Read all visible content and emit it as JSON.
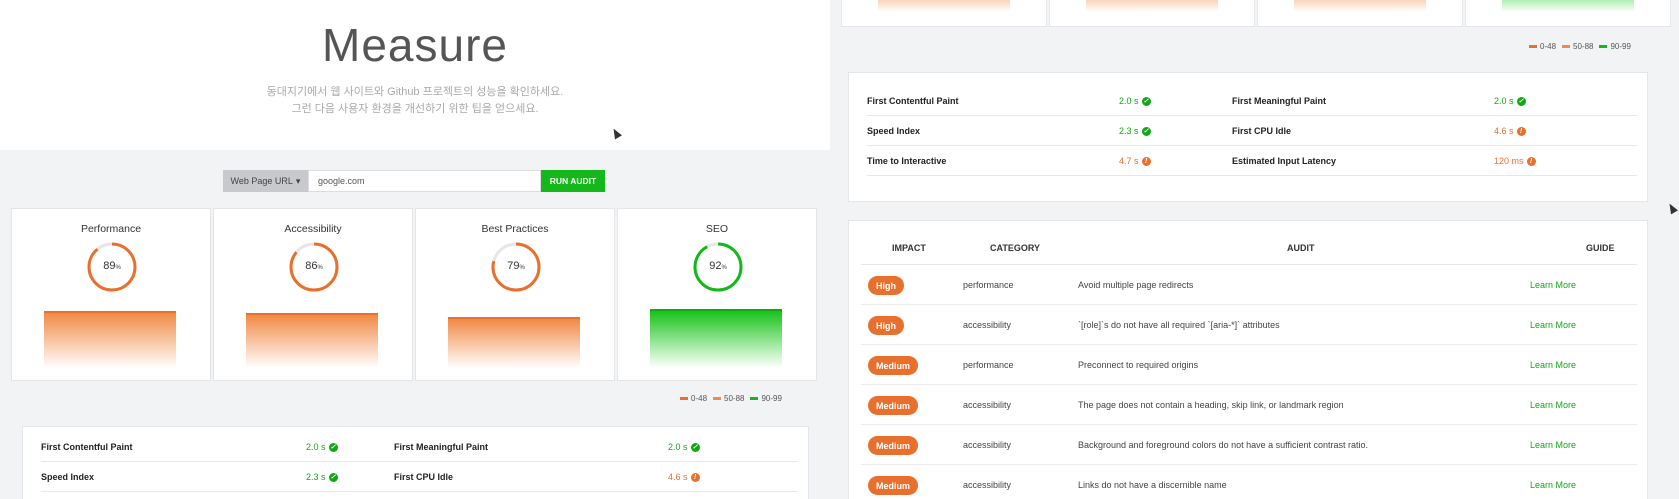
{
  "hero": {
    "title": "Measure",
    "subtitle_line1": "동대지기에서 웹 사이트와 Github 프로젝트의 성능을 확인하세요.",
    "subtitle_line2": "그런 다음 사용자 환경을 개선하기 위한 팁을 얻으세요."
  },
  "form": {
    "type_label": "Web Page URL",
    "url_value": "google.com",
    "run_label": "RUN AUDIT"
  },
  "categories": [
    {
      "title": "Performance",
      "score": "89",
      "pct": 0.89,
      "status": "orange"
    },
    {
      "title": "Accessibility",
      "score": "86",
      "pct": 0.86,
      "status": "orange"
    },
    {
      "title": "Best Practices",
      "score": "79",
      "pct": 0.79,
      "status": "orange"
    },
    {
      "title": "SEO",
      "score": "92",
      "pct": 0.92,
      "status": "green"
    }
  ],
  "score_unit": "%",
  "legend": [
    {
      "label": "0-48",
      "color": "#e8702c"
    },
    {
      "label": "50-88",
      "color": "#f08a45"
    },
    {
      "label": "90-99",
      "color": "#15b81a"
    }
  ],
  "metrics": [
    {
      "label": "First Contentful Paint",
      "value": "2.0 s",
      "status": "good"
    },
    {
      "label": "First Meaningful Paint",
      "value": "2.0 s",
      "status": "good"
    },
    {
      "label": "Speed Index",
      "value": "2.3 s",
      "status": "good"
    },
    {
      "label": "First CPU Idle",
      "value": "4.6 s",
      "status": "warn"
    },
    {
      "label": "Time to Interactive",
      "value": "4.7 s",
      "status": "warn"
    },
    {
      "label": "Estimated Input Latency",
      "value": "120 ms",
      "status": "warn"
    }
  ],
  "audit_headers": {
    "impact": "IMPACT",
    "category": "CATEGORY",
    "audit": "AUDIT",
    "guide": "GUIDE"
  },
  "audits": [
    {
      "impact": "High",
      "category": "performance",
      "audit": "Avoid multiple page redirects",
      "guide": "Learn More"
    },
    {
      "impact": "High",
      "category": "accessibility",
      "audit": "`[role]`s do not have all required `[aria-*]` attributes",
      "guide": "Learn More"
    },
    {
      "impact": "Medium",
      "category": "performance",
      "audit": "Preconnect to required origins",
      "guide": "Learn More"
    },
    {
      "impact": "Medium",
      "category": "accessibility",
      "audit": "The page does not contain a heading, skip link, or landmark region",
      "guide": "Learn More"
    },
    {
      "impact": "Medium",
      "category": "accessibility",
      "audit": "Background and foreground colors do not have a sufficient contrast ratio.",
      "guide": "Learn More"
    },
    {
      "impact": "Medium",
      "category": "accessibility",
      "audit": "Links do not have a discernible name",
      "guide": "Learn More"
    }
  ],
  "colors": {
    "orange": "#e8702c",
    "green": "#15b81a"
  }
}
